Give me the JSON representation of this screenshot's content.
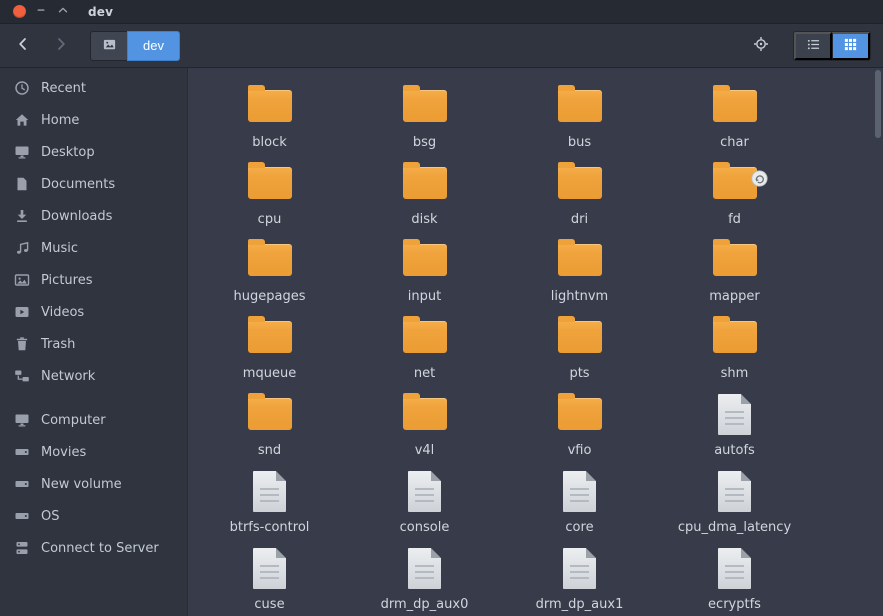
{
  "window": {
    "title": "dev"
  },
  "toolbar": {
    "breadcrumb": "dev"
  },
  "sidebar": {
    "places": [
      {
        "label": "Recent",
        "icon": "clock-icon"
      },
      {
        "label": "Home",
        "icon": "home-icon"
      },
      {
        "label": "Desktop",
        "icon": "desktop-icon"
      },
      {
        "label": "Documents",
        "icon": "documents-icon"
      },
      {
        "label": "Downloads",
        "icon": "downloads-icon"
      },
      {
        "label": "Music",
        "icon": "music-icon"
      },
      {
        "label": "Pictures",
        "icon": "pictures-icon"
      },
      {
        "label": "Videos",
        "icon": "videos-icon"
      },
      {
        "label": "Trash",
        "icon": "trash-icon"
      },
      {
        "label": "Network",
        "icon": "network-icon"
      }
    ],
    "devices": [
      {
        "label": "Computer",
        "icon": "computer-icon"
      },
      {
        "label": "Movies",
        "icon": "drive-icon"
      },
      {
        "label": "New volume",
        "icon": "drive-icon"
      },
      {
        "label": "OS",
        "icon": "drive-icon"
      },
      {
        "label": "Connect to Server",
        "icon": "server-icon"
      }
    ]
  },
  "files": [
    {
      "name": "block",
      "type": "folder"
    },
    {
      "name": "bsg",
      "type": "folder"
    },
    {
      "name": "bus",
      "type": "folder"
    },
    {
      "name": "char",
      "type": "folder"
    },
    {
      "name": "cpu",
      "type": "folder"
    },
    {
      "name": "disk",
      "type": "folder"
    },
    {
      "name": "dri",
      "type": "folder"
    },
    {
      "name": "fd",
      "type": "folder",
      "emblem": "symlink"
    },
    {
      "name": "hugepages",
      "type": "folder"
    },
    {
      "name": "input",
      "type": "folder"
    },
    {
      "name": "lightnvm",
      "type": "folder"
    },
    {
      "name": "mapper",
      "type": "folder"
    },
    {
      "name": "mqueue",
      "type": "folder"
    },
    {
      "name": "net",
      "type": "folder"
    },
    {
      "name": "pts",
      "type": "folder"
    },
    {
      "name": "shm",
      "type": "folder"
    },
    {
      "name": "snd",
      "type": "folder"
    },
    {
      "name": "v4l",
      "type": "folder"
    },
    {
      "name": "vfio",
      "type": "folder"
    },
    {
      "name": "autofs",
      "type": "file"
    },
    {
      "name": "btrfs-control",
      "type": "file"
    },
    {
      "name": "console",
      "type": "file"
    },
    {
      "name": "core",
      "type": "file"
    },
    {
      "name": "cpu_dma_latency",
      "type": "file"
    },
    {
      "name": "cuse",
      "type": "file"
    },
    {
      "name": "drm_dp_aux0",
      "type": "file"
    },
    {
      "name": "drm_dp_aux1",
      "type": "file"
    },
    {
      "name": "ecryptfs",
      "type": "file"
    }
  ],
  "colors": {
    "accent": "#5294e2",
    "folder": "#f0a33c",
    "titlebar_bg": "#262b33",
    "toolbar_bg": "#2f343f",
    "sidebar_bg": "#2f343f",
    "content_bg": "#383c4a",
    "text": "#d3dae3",
    "close": "#f0603f"
  }
}
